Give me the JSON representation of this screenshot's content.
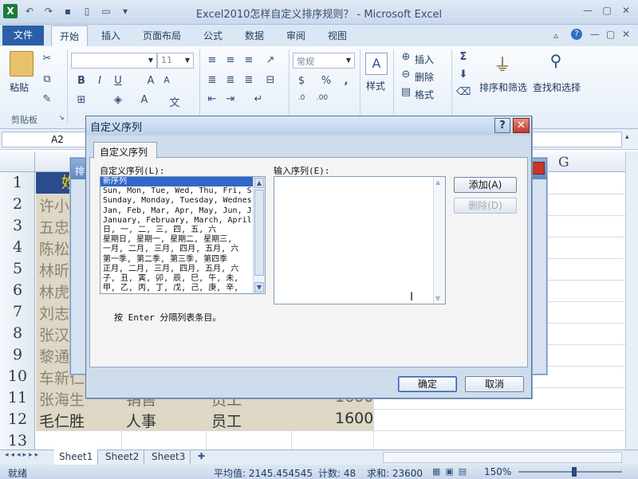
{
  "window": {
    "title": "Excel2010怎样自定义排序规则？ - Microsoft Excel"
  },
  "ribbon": {
    "file_tab": "文件",
    "tabs": [
      "开始",
      "插入",
      "页面布局",
      "公式",
      "数据",
      "审阅",
      "视图"
    ],
    "font_size": "11",
    "number_format": "常规",
    "paste_label": "粘贴",
    "clipboard_label": "剪贴板",
    "style_label": "样式",
    "insert_label": "插入",
    "delete_label": "删除",
    "format_label": "格式",
    "sort_filter_label": "排序和筛选",
    "find_select_label": "查找和选择"
  },
  "formula_bar": {
    "name_box": "A2"
  },
  "sheet": {
    "col_g": "G",
    "row_numbers": [
      "1",
      "2",
      "3",
      "4",
      "5",
      "6",
      "7",
      "8",
      "9",
      "10",
      "11",
      "12",
      "13"
    ],
    "header_cell": "姓",
    "names": [
      "许小",
      "五忠",
      "陈松",
      "林昕",
      "林虎",
      "刘志",
      "张汉",
      "黎通",
      "车新仁",
      "张海生",
      "毛仁胜"
    ],
    "row11": {
      "dept": "销售",
      "role": "员工",
      "value": "1600"
    },
    "row12": {
      "dept": "人事",
      "role": "员工",
      "value": "1600"
    }
  },
  "sheet_tabs": [
    "Sheet1",
    "Sheet2",
    "Sheet3"
  ],
  "status": {
    "ready": "就绪",
    "avg": "平均值: 2145.454545",
    "count": "计数: 48",
    "sum": "求和: 23600",
    "zoom": "150%"
  },
  "back_dialog": {
    "title": "排"
  },
  "dialog": {
    "title": "自定义序列",
    "tab": "自定义序列",
    "list_label": "自定义序列(L):",
    "input_label": "输入序列(E):",
    "list_items": [
      "新序列",
      "Sun, Mon, Tue, Wed, Thu, Fri, S",
      "Sunday, Monday, Tuesday, Wednes",
      "Jan, Feb, Mar, Apr, May, Jun, J",
      "January, February, March, April",
      "日, 一, 二, 三, 四, 五, 六",
      "星期日, 星期一, 星期二, 星期三,",
      "一月, 二月, 三月, 四月, 五月, 六",
      "第一季, 第二季, 第三季, 第四季",
      "正月, 二月, 三月, 四月, 五月, 六",
      "子, 丑, 寅, 卯, 辰, 巳, 午, 未,",
      "甲, 乙, 丙, 丁, 戊, 己, 庚, 辛,"
    ],
    "add_button": "添加(A)",
    "delete_button": "删除(D)",
    "hint": "按 Enter 分隔列表条目。",
    "ok_button": "确定",
    "cancel_button": "取消"
  }
}
